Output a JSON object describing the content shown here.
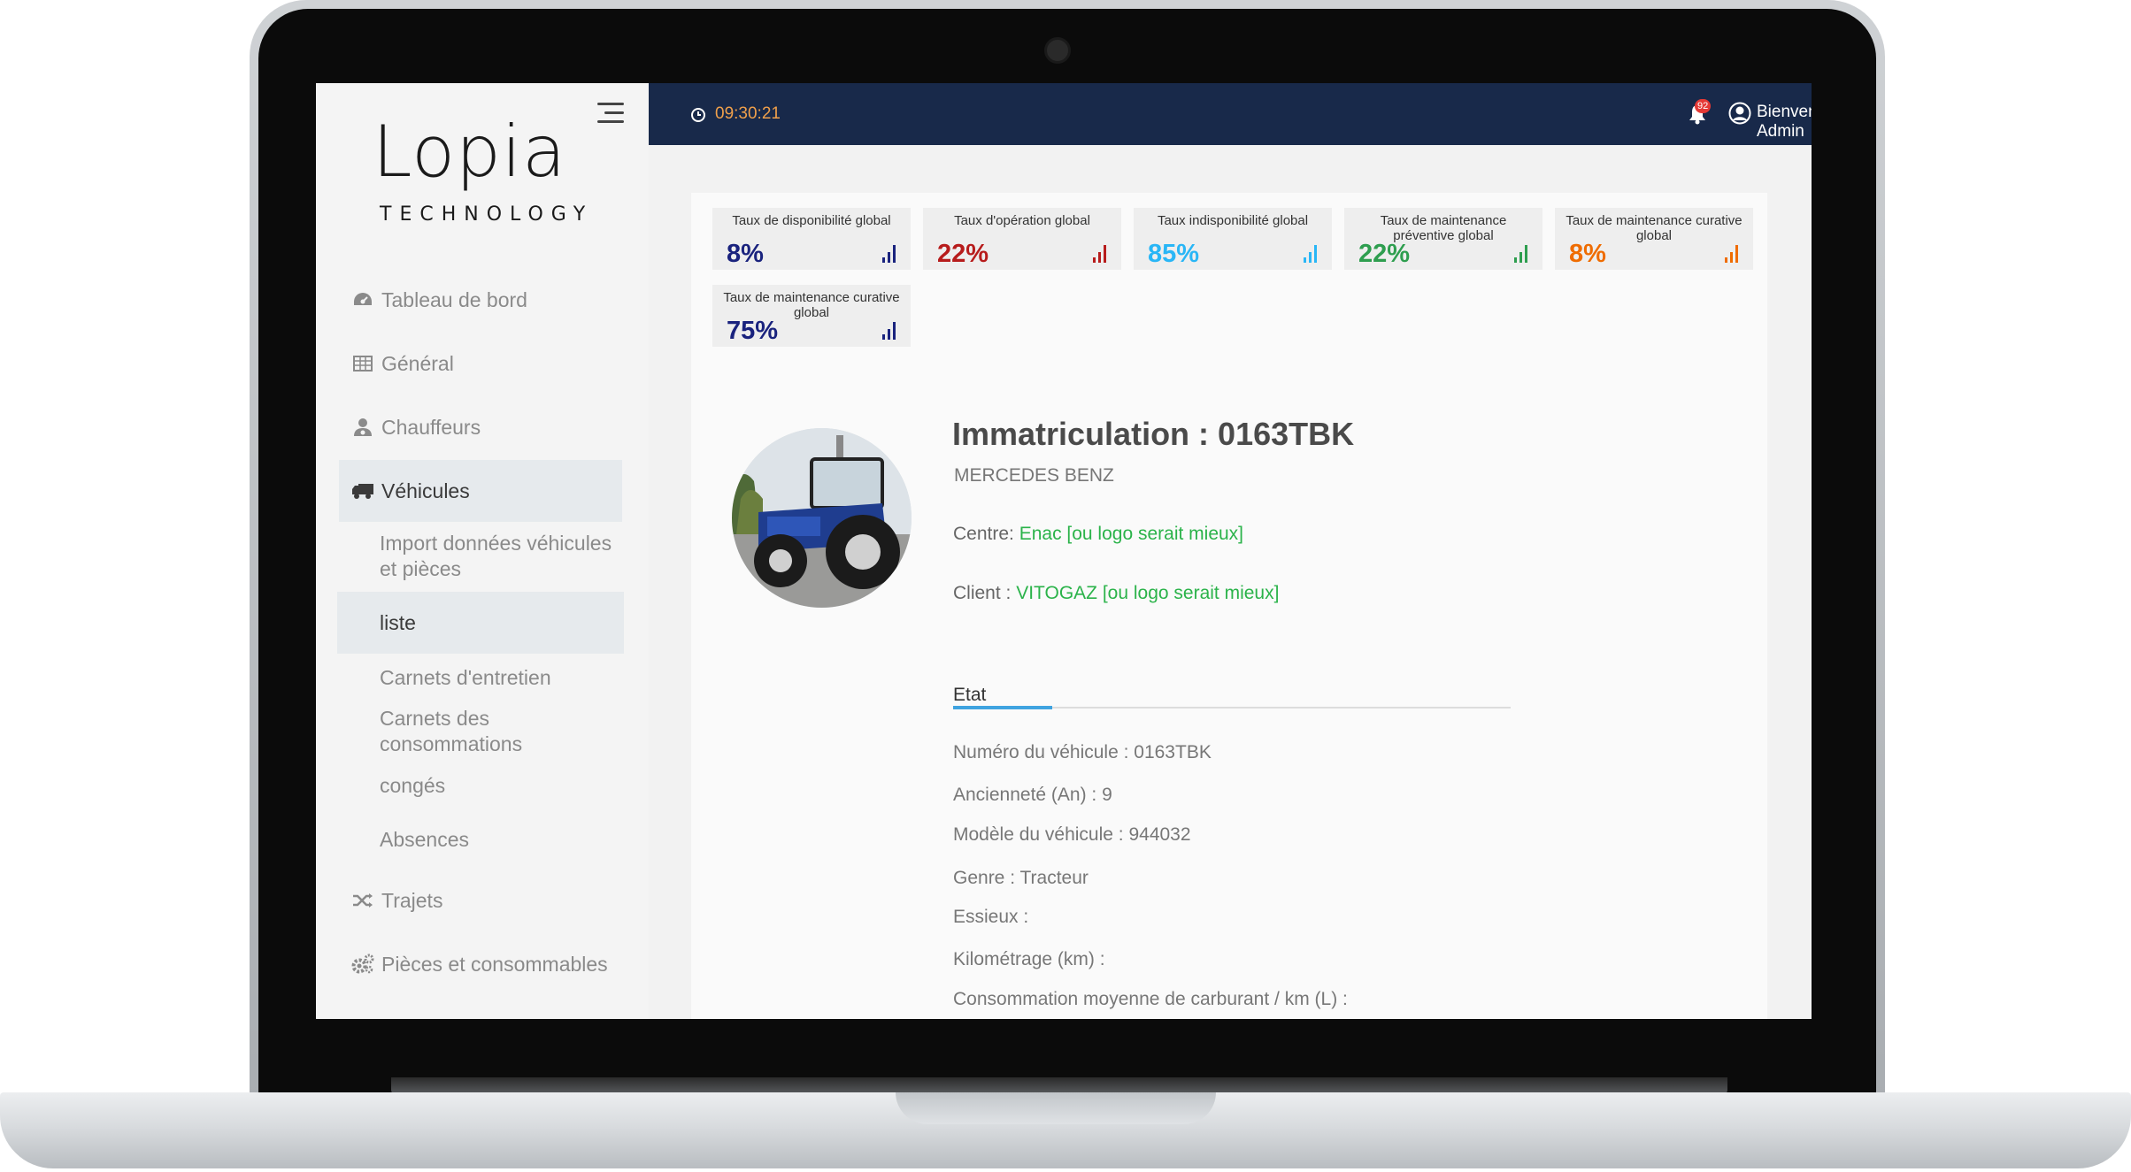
{
  "app": {
    "logo_main": "Lopia",
    "logo_sub": "TECHNOLOGY"
  },
  "topbar": {
    "time": "09:30:21",
    "notification_count": "92",
    "welcome": "Bienvenue Admin"
  },
  "sidebar": {
    "items": [
      {
        "label": "Tableau de bord",
        "icon": "dashboard-icon"
      },
      {
        "label": "Général",
        "icon": "table-icon"
      },
      {
        "label": "Chauffeurs",
        "icon": "driver-icon"
      },
      {
        "label": "Véhicules",
        "icon": "truck-icon"
      }
    ],
    "vehicle_subitems": [
      {
        "label": "Import données véhicules et pièces"
      },
      {
        "label": "liste"
      },
      {
        "label": "Carnets d'entretien"
      },
      {
        "label": "Carnets des consommations"
      },
      {
        "label": "congés"
      },
      {
        "label": "Absences"
      }
    ],
    "items_after": [
      {
        "label": "Trajets",
        "icon": "shuffle-icon"
      },
      {
        "label": "Pièces et consommables",
        "icon": "gears-icon"
      }
    ]
  },
  "kpis": [
    {
      "label": "Taux de disponibilité global",
      "value": "8%",
      "color": "#1a237e"
    },
    {
      "label": "Taux d'opération global",
      "value": "22%",
      "color": "#b71c1c"
    },
    {
      "label": "Taux indisponibilité global",
      "value": "85%",
      "color": "#29b6f6"
    },
    {
      "label": "Taux de maintenance préventive global",
      "value": "22%",
      "color": "#2e9e4f"
    },
    {
      "label": "Taux de maintenance curative global",
      "value": "8%",
      "color": "#ef6c00"
    },
    {
      "label": "Taux de maintenance curative global",
      "value": "75%",
      "color": "#1a237e"
    }
  ],
  "vehicle": {
    "title": "Immatriculation :  0163TBK",
    "brand": "MERCEDES BENZ",
    "centre_label": "Centre: ",
    "centre_value": "Enac [ou logo serait mieux]",
    "client_label": "Client :  ",
    "client_value": "VITOGAZ [ou logo serait mieux]"
  },
  "etat": {
    "tab_label": "Etat",
    "specs": [
      "Numéro du véhicule : 0163TBK",
      "Ancienneté (An) : 9",
      "Modèle du véhicule : 944032",
      "Genre : Tracteur",
      "Essieux :",
      "Kilométrage (km) :",
      "Consommation moyenne de carburant / km (L) :"
    ]
  }
}
